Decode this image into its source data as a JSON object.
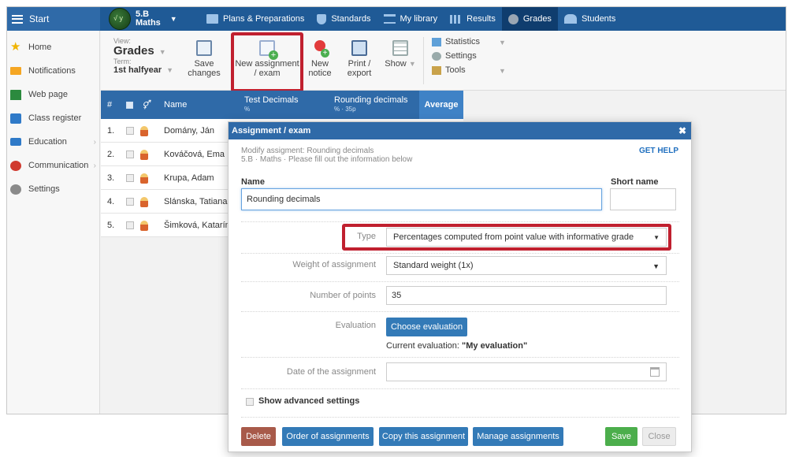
{
  "topbar": {
    "start_label": "Start",
    "class_name": "5.B",
    "class_subject": "Maths",
    "nav": [
      {
        "label": "Plans & Preparations",
        "icon": "plans-icon"
      },
      {
        "label": "Standards",
        "icon": "shield-icon"
      },
      {
        "label": "My library",
        "icon": "library-icon"
      },
      {
        "label": "Results",
        "icon": "bar-chart-icon"
      },
      {
        "label": "Grades",
        "icon": "grades-icon",
        "active": true
      },
      {
        "label": "Students",
        "icon": "students-icon"
      }
    ]
  },
  "sidebar": {
    "items": [
      {
        "label": "Home",
        "icon": "star-icon"
      },
      {
        "label": "Notifications",
        "icon": "envelope-icon"
      },
      {
        "label": "Web page",
        "icon": "web-page-icon"
      },
      {
        "label": "Class register",
        "icon": "register-icon"
      },
      {
        "label": "Education",
        "icon": "book-icon",
        "has_submenu": true
      },
      {
        "label": "Communication",
        "icon": "chat-icon",
        "has_submenu": true
      },
      {
        "label": "Settings",
        "icon": "gear-icon"
      }
    ]
  },
  "toolbar": {
    "view_label": "View:",
    "view_value": "Grades",
    "term_label": "Term:",
    "term_value": "1st halfyear",
    "save_label_1": "Save",
    "save_label_2": "changes",
    "new_assignment_1": "New assignment",
    "new_assignment_2": "/ exam",
    "new_notice_1": "New",
    "new_notice_2": "notice",
    "print_1": "Print /",
    "print_2": "export",
    "show_label": "Show",
    "statistics": "Statistics",
    "settings": "Settings",
    "tools": "Tools"
  },
  "grid": {
    "col_num": "#",
    "col_name": "Name",
    "col_test": "Test Decimals",
    "col_test_sub": "%",
    "col_round": "Rounding decimals",
    "col_round_sub": "% · 35p",
    "col_avg": "Average",
    "rows": [
      {
        "num": "1.",
        "name": "Domány, Ján"
      },
      {
        "num": "2.",
        "name": "Kováčová, Ema"
      },
      {
        "num": "3.",
        "name": "Krupa, Adam"
      },
      {
        "num": "4.",
        "name": "Slánska, Tatiana"
      },
      {
        "num": "5.",
        "name": "Šimková, Katarína"
      }
    ]
  },
  "modal": {
    "title": "Assignment / exam",
    "close": "✖",
    "subtitle_1": "Modify assigment: Rounding decimals",
    "subtitle_2": "5.B · Maths · Please fill out the information below",
    "help": "GET HELP",
    "name_label": "Name",
    "name_value": "Rounding decimals",
    "short_name_label": "Short name",
    "short_name_value": "",
    "type_label": "Type",
    "type_value": "Percentages computed from point value with informative grade",
    "weight_label": "Weight of assignment",
    "weight_value": "Standard weight (1x)",
    "points_label": "Number of points",
    "points_value": "35",
    "evaluation_label": "Evaluation",
    "choose_evaluation": "Choose evaluation",
    "current_eval_label": "Current evaluation:",
    "current_eval_value": "\"My evaluation\"",
    "date_label": "Date of the assignment",
    "date_value": "",
    "advanced": "Show advanced settings",
    "buttons": {
      "delete": "Delete",
      "order": "Order of assignments",
      "copy": "Copy this assignment",
      "manage": "Manage assignments",
      "save": "Save",
      "close": "Close"
    }
  },
  "colors": {
    "topbar": "#1f5a96",
    "accent": "#337ab7",
    "highlight": "#c0202f",
    "save": "#4cae4c",
    "delete": "#a85a4a"
  }
}
